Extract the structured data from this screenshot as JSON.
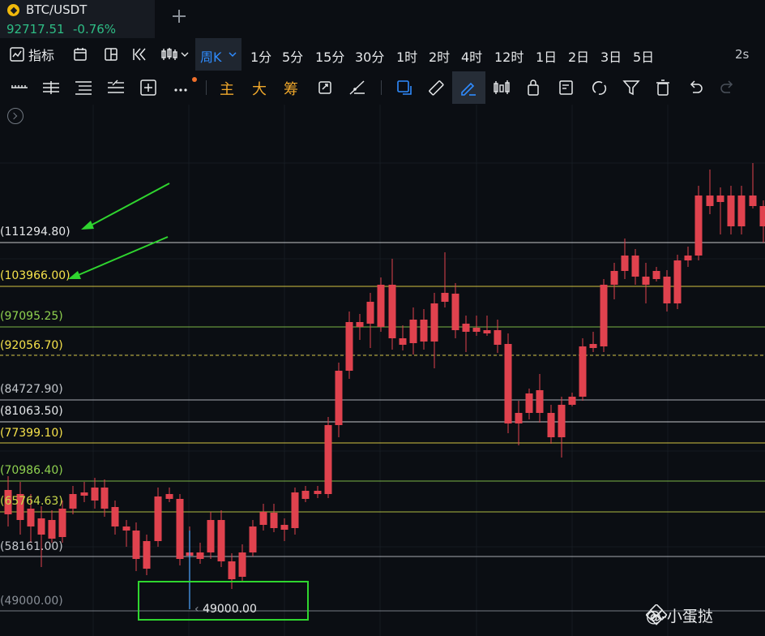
{
  "header": {
    "pair": "BTC/USDT",
    "price": "92717.51",
    "change": "-0.76%",
    "add_tab_icon": "plus-icon"
  },
  "toolbar": {
    "indicator_label": "指标",
    "active_timeframe": "周K",
    "timeframes": [
      "1分",
      "5分",
      "15分",
      "30分",
      "1时",
      "2时",
      "4时",
      "12时",
      "1日",
      "2日",
      "3日",
      "5日"
    ],
    "refresh_label": "2s"
  },
  "draw_toolbar": {
    "main_label": "主",
    "big_label": "大",
    "chip_label": "筹"
  },
  "chart": {
    "levels": [
      {
        "label": "(111294.80)",
        "color": "#e6e8ea"
      },
      {
        "label": "(103966.00)",
        "color": "#f6e24a"
      },
      {
        "label": "(97095.25)",
        "color": "#8fd14f"
      },
      {
        "label": "(92056.70)",
        "color": "#f6e24a"
      },
      {
        "label": "(84727.90)",
        "color": "#c3c7cc"
      },
      {
        "label": "(81063.50)",
        "color": "#e6e8ea"
      },
      {
        "label": "(77399.10)",
        "color": "#f6e24a"
      },
      {
        "label": "(70986.40)",
        "color": "#8fd14f"
      },
      {
        "label": "(65764.63)",
        "color": "#c9d94a"
      },
      {
        "label": "(58161.00)",
        "color": "#c3c7cc"
      },
      {
        "label": "(49000.00)",
        "color": "#8a9098"
      }
    ],
    "min_marker": "49000.00",
    "candle_up_color": "#2ebd85",
    "candle_down_color": "#e0424e",
    "annotation_color": "#2fd52f"
  },
  "watermark": {
    "text": "@-小蛋挞",
    "icon": "binance-square-icon"
  }
}
